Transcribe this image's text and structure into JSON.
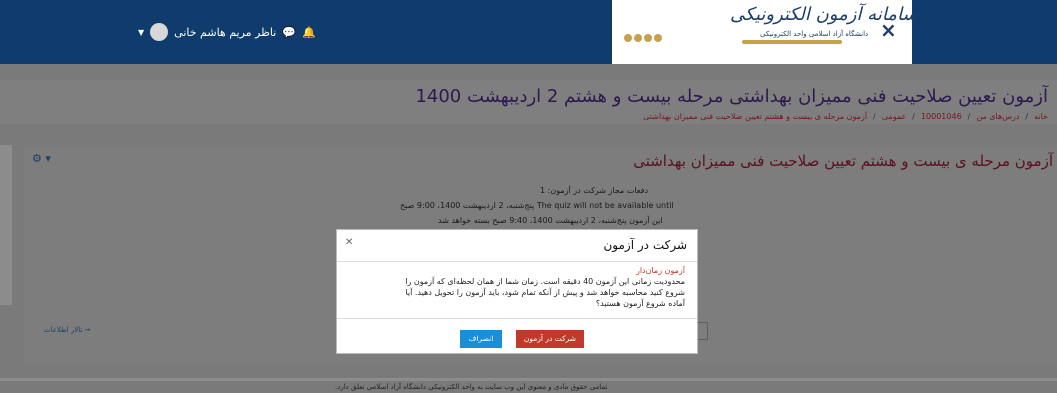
{
  "navbar": {
    "username": "ناظر مریم هاشم خانی",
    "banner_title": "سامانه آزمون الکترونیکی",
    "banner_subtitle": "دانشگاه آزاد اسلامی واحد الکترونیکی",
    "close_glyph": "×"
  },
  "page": {
    "title": "آزمون تعیین صلاحیت فنی ممیزان بهداشتی مرحله بیست و هشتم 2 اردیبهشت 1400",
    "breadcrumb": [
      "خانه",
      "درس‌های من",
      "10001046",
      "عمومی",
      "آزمون مرحله ی بیست و هشتم تعیین صلاحیت فنی ممیزان بهداشتی"
    ]
  },
  "quiz": {
    "title": "آزمون مرحله ی بیست و هشتم تعیین صلاحیت فنی ممیزان بهداشتی",
    "attempts_allowed": "دفعات مجاز شرکت در آزمون: 1",
    "opens": "The quiz will not be available until پنج‌شنبه، 2 اردیبهشت 1400، 9:00 صبح",
    "closes": "این آزمون پنج‌شنبه، 2 اردیبهشت 1400، 9:40 صبح بسته خواهد شد",
    "nav_left": "تالار اطلاعات →"
  },
  "modal": {
    "title": "شرکت در آزمون",
    "subtitle": "آزمون زمان‌دار",
    "body": "محدودیت زمانی این آزمون 40 دقیقه است. زمان شما از همان لحظه‌ای که آزمون را شروع کنید محاسبه خواهد شد و پیش از آنکه تمام شود، باید آزمون را تحویل دهید. آیا آماده شروع آزمون هستید؟",
    "start_button": "شرکت در آزمون",
    "cancel_button": "انصراف",
    "close_glyph": "✕"
  },
  "footer": {
    "text": "تمامی حقوق مادی و معنوی این وب سایت به واحد الکترونیکی دانشگاه آزاد اسلامی تعلق دارد."
  },
  "colors": {
    "navbar": "#0f3b6d",
    "accent_red": "#c0392b",
    "accent_blue": "#1a8ed6",
    "banner_gold": "#c7a04a"
  }
}
